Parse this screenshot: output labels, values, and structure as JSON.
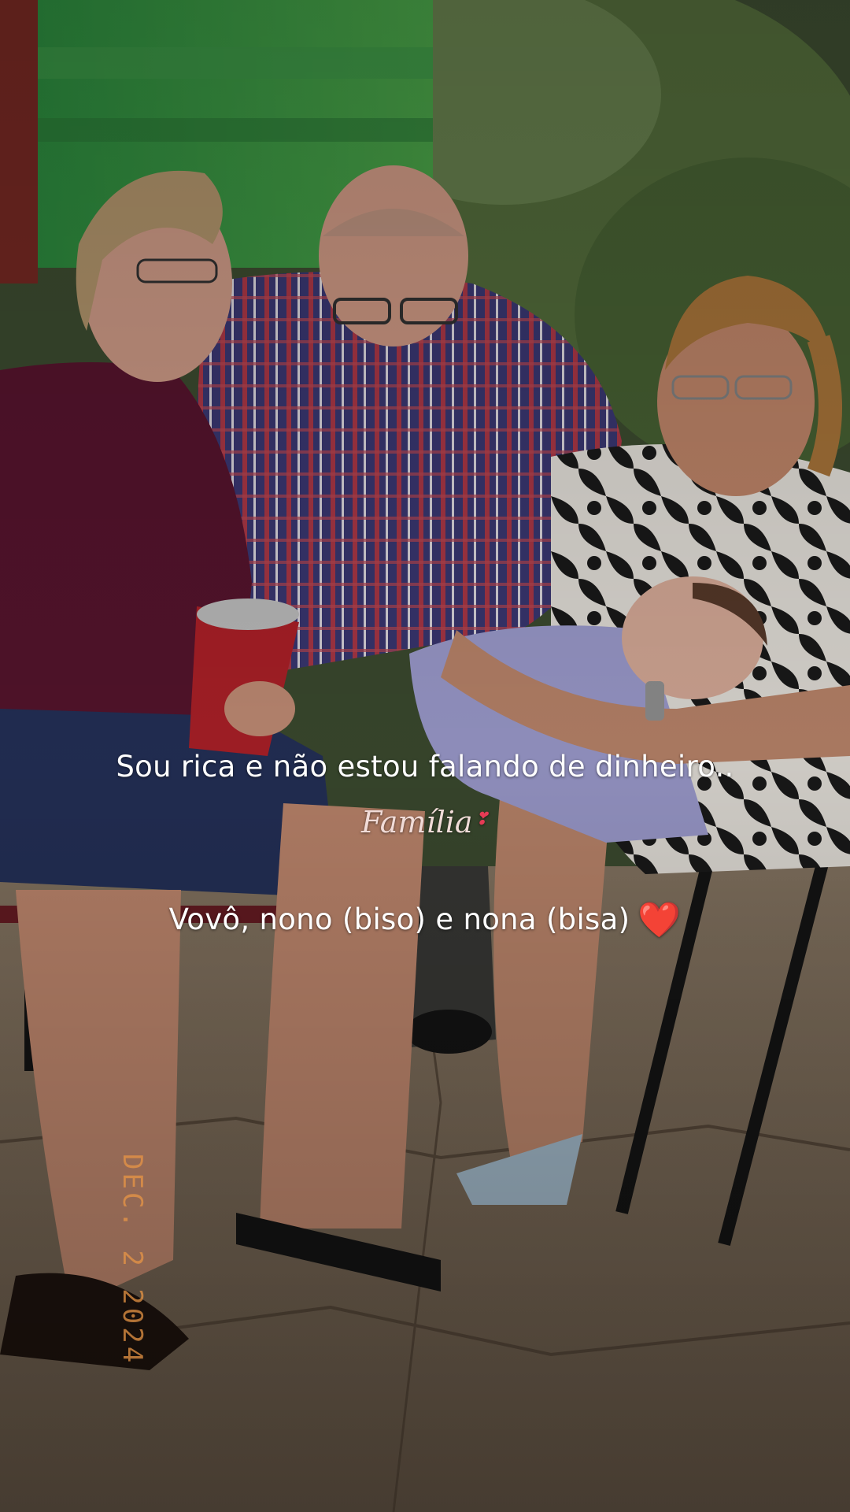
{
  "story": {
    "caption_line_1": "Sou rica e não estou falando de dinheiro..",
    "sticker_text": "Família",
    "caption_line_2": "Vovô, nono (biso) e nona (bisa)",
    "heart_emoji": "❤️",
    "date_stamp": "DEC. 2 2024"
  },
  "colors": {
    "caption_text": "#ffffff",
    "heart": "#e0182d",
    "date_stamp": "#e8964680"
  }
}
